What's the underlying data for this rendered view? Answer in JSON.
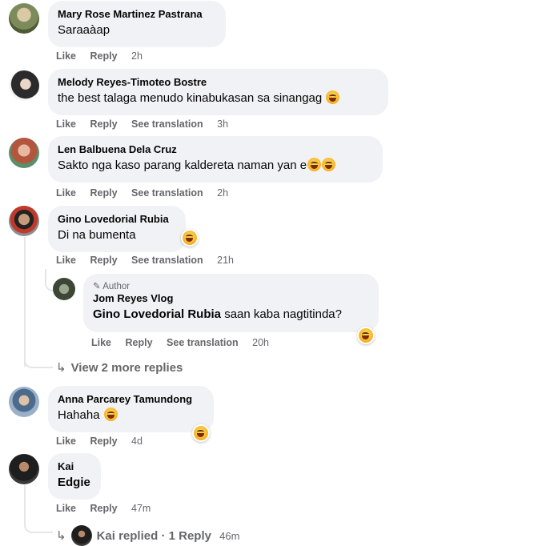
{
  "comments": [
    {
      "author": "Mary Rose Martinez Pastrana",
      "text": "Saraaàap",
      "actions": {
        "like": "Like",
        "reply": "Reply",
        "time": "2h"
      }
    },
    {
      "author": "Melody Reyes-Timoteo Bostre",
      "text": "the best talaga menudo kinabukasan sa sinangag",
      "actions": {
        "like": "Like",
        "reply": "Reply",
        "see_translation": "See translation",
        "time": "3h"
      }
    },
    {
      "author": "Len Balbuena Dela Cruz",
      "text": "Sakto nga kaso parang kaldereta naman yan e",
      "actions": {
        "like": "Like",
        "reply": "Reply",
        "see_translation": "See translation",
        "time": "2h"
      }
    },
    {
      "author": "Gino Lovedorial Rubia",
      "text": "Di na bumenta",
      "actions": {
        "like": "Like",
        "reply": "Reply",
        "see_translation": "See translation",
        "time": "21h"
      },
      "reply": {
        "badge": "Author",
        "author": "Jom Reyes Vlog",
        "mention": "Gino Lovedorial Rubia",
        "text": "saan kaba nagtitinda?",
        "actions": {
          "like": "Like",
          "reply": "Reply",
          "see_translation": "See translation",
          "time": "20h"
        }
      },
      "more_replies": "View 2 more replies"
    },
    {
      "author": "Anna Parcarey Tamundong",
      "text": "Hahaha",
      "actions": {
        "like": "Like",
        "reply": "Reply",
        "time": "4d"
      }
    },
    {
      "author": "Kai",
      "text": "Edgie",
      "actions": {
        "like": "Like",
        "reply": "Reply",
        "time": "47m"
      },
      "replied": {
        "text": "Kai replied · 1 Reply",
        "time": "46m"
      }
    }
  ],
  "icons": {
    "reply_arrow": "reply-arrow-icon",
    "author_badge": "pencil-icon",
    "emoji": "laughing-emoji-icon"
  },
  "colors": {
    "bubble": "#f0f2f5",
    "meta_text": "#65676b",
    "text": "#050505"
  }
}
